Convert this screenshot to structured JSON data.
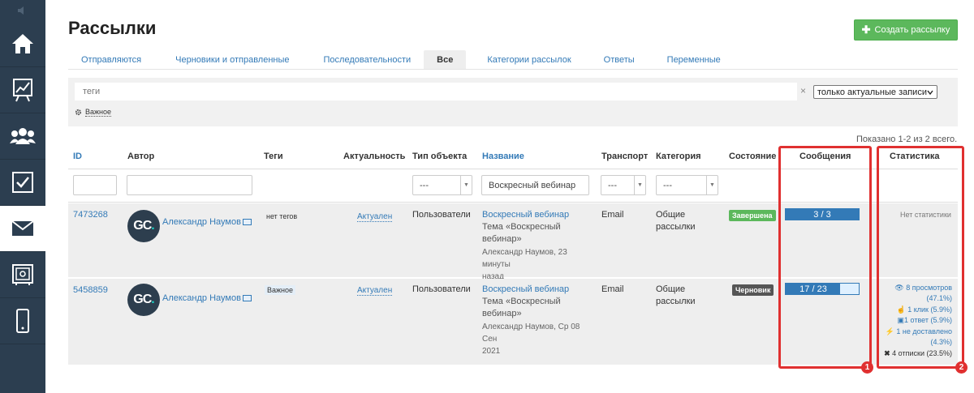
{
  "page": {
    "title": "Рассылки"
  },
  "actions": {
    "create_label": "Создать рассылку",
    "create_icon": "plus-icon"
  },
  "tabs": [
    {
      "label": "Отправляются",
      "active": false
    },
    {
      "label": "Черновики и отправленные",
      "active": false
    },
    {
      "label": "Последовательности",
      "active": false
    },
    {
      "label": "Все",
      "active": true
    },
    {
      "label": "Категории рассылок",
      "active": false
    },
    {
      "label": "Ответы",
      "active": false
    },
    {
      "label": "Переменные",
      "active": false
    }
  ],
  "filters": {
    "tags_placeholder": "теги",
    "clear_symbol": "×",
    "actuality_select": "только актуальные записи",
    "important_tag": "Важное"
  },
  "summary": "Показано 1-2 из 2 всего.",
  "columns": {
    "id": "ID",
    "author": "Автор",
    "tags": "Теги",
    "actuality": "Актуальность",
    "object_type": "Тип объекта",
    "name": "Название",
    "transport": "Транспорт",
    "category": "Категория",
    "state": "Состояние",
    "messages": "Сообщения",
    "stats": "Статистика"
  },
  "column_filters": {
    "object_type": "---",
    "name": "Воскресный вебинар",
    "transport": "---",
    "category": "---"
  },
  "rows": [
    {
      "id": "7473268",
      "avatar_text": "GC",
      "avatar_dot": ".",
      "author": "Александр Наумов",
      "tags": "нет тегов",
      "actuality": "Актуален",
      "object_type": "Пользователи",
      "name": "Воскресный вебинар",
      "subject_1": "Тема «Воскресный",
      "subject_2": "вебинар»",
      "meta_1": "Александр Наумов, 23 минуты",
      "meta_2": "назад",
      "transport": "Email",
      "category_1": "Общие",
      "category_2": "рассылки",
      "state": "Завершена",
      "messages_text": "3 / 3",
      "messages_sent": 3,
      "messages_total": 3,
      "no_stats": "Нет статистики"
    },
    {
      "id": "5458859",
      "avatar_text": "GC",
      "avatar_dot": ".",
      "author": "Александр Наумов",
      "tags": "Важное",
      "actuality": "Актуален",
      "object_type": "Пользователи",
      "name": "Воскресный вебинар",
      "subject_1": "Тема «Воскресный",
      "subject_2": "вебинар»",
      "meta_1": "Александр Наумов, Ср 08 Сен",
      "meta_2": "2021",
      "transport": "Email",
      "category_1": "Общие",
      "category_2": "рассылки",
      "state": "Черновик",
      "messages_text": "17 / 23",
      "messages_sent": 17,
      "messages_total": 23,
      "stats": {
        "views": "8 просмотров",
        "views_pct": "(47.1%)",
        "clicks": "1 клик (5.9%)",
        "replies": "1 ответ (5.9%)",
        "undelivered": "1 не доставлено",
        "undelivered_pct": "(4.3%)",
        "unsubscribes": "4 отписки (23.5%)"
      }
    }
  ],
  "annotations": {
    "marker_1": "1",
    "marker_2": "2"
  },
  "colors": {
    "accent": "#337ab7",
    "sidebar": "#2c3e50",
    "success": "#5cb85c",
    "annotation": "#e03030"
  }
}
